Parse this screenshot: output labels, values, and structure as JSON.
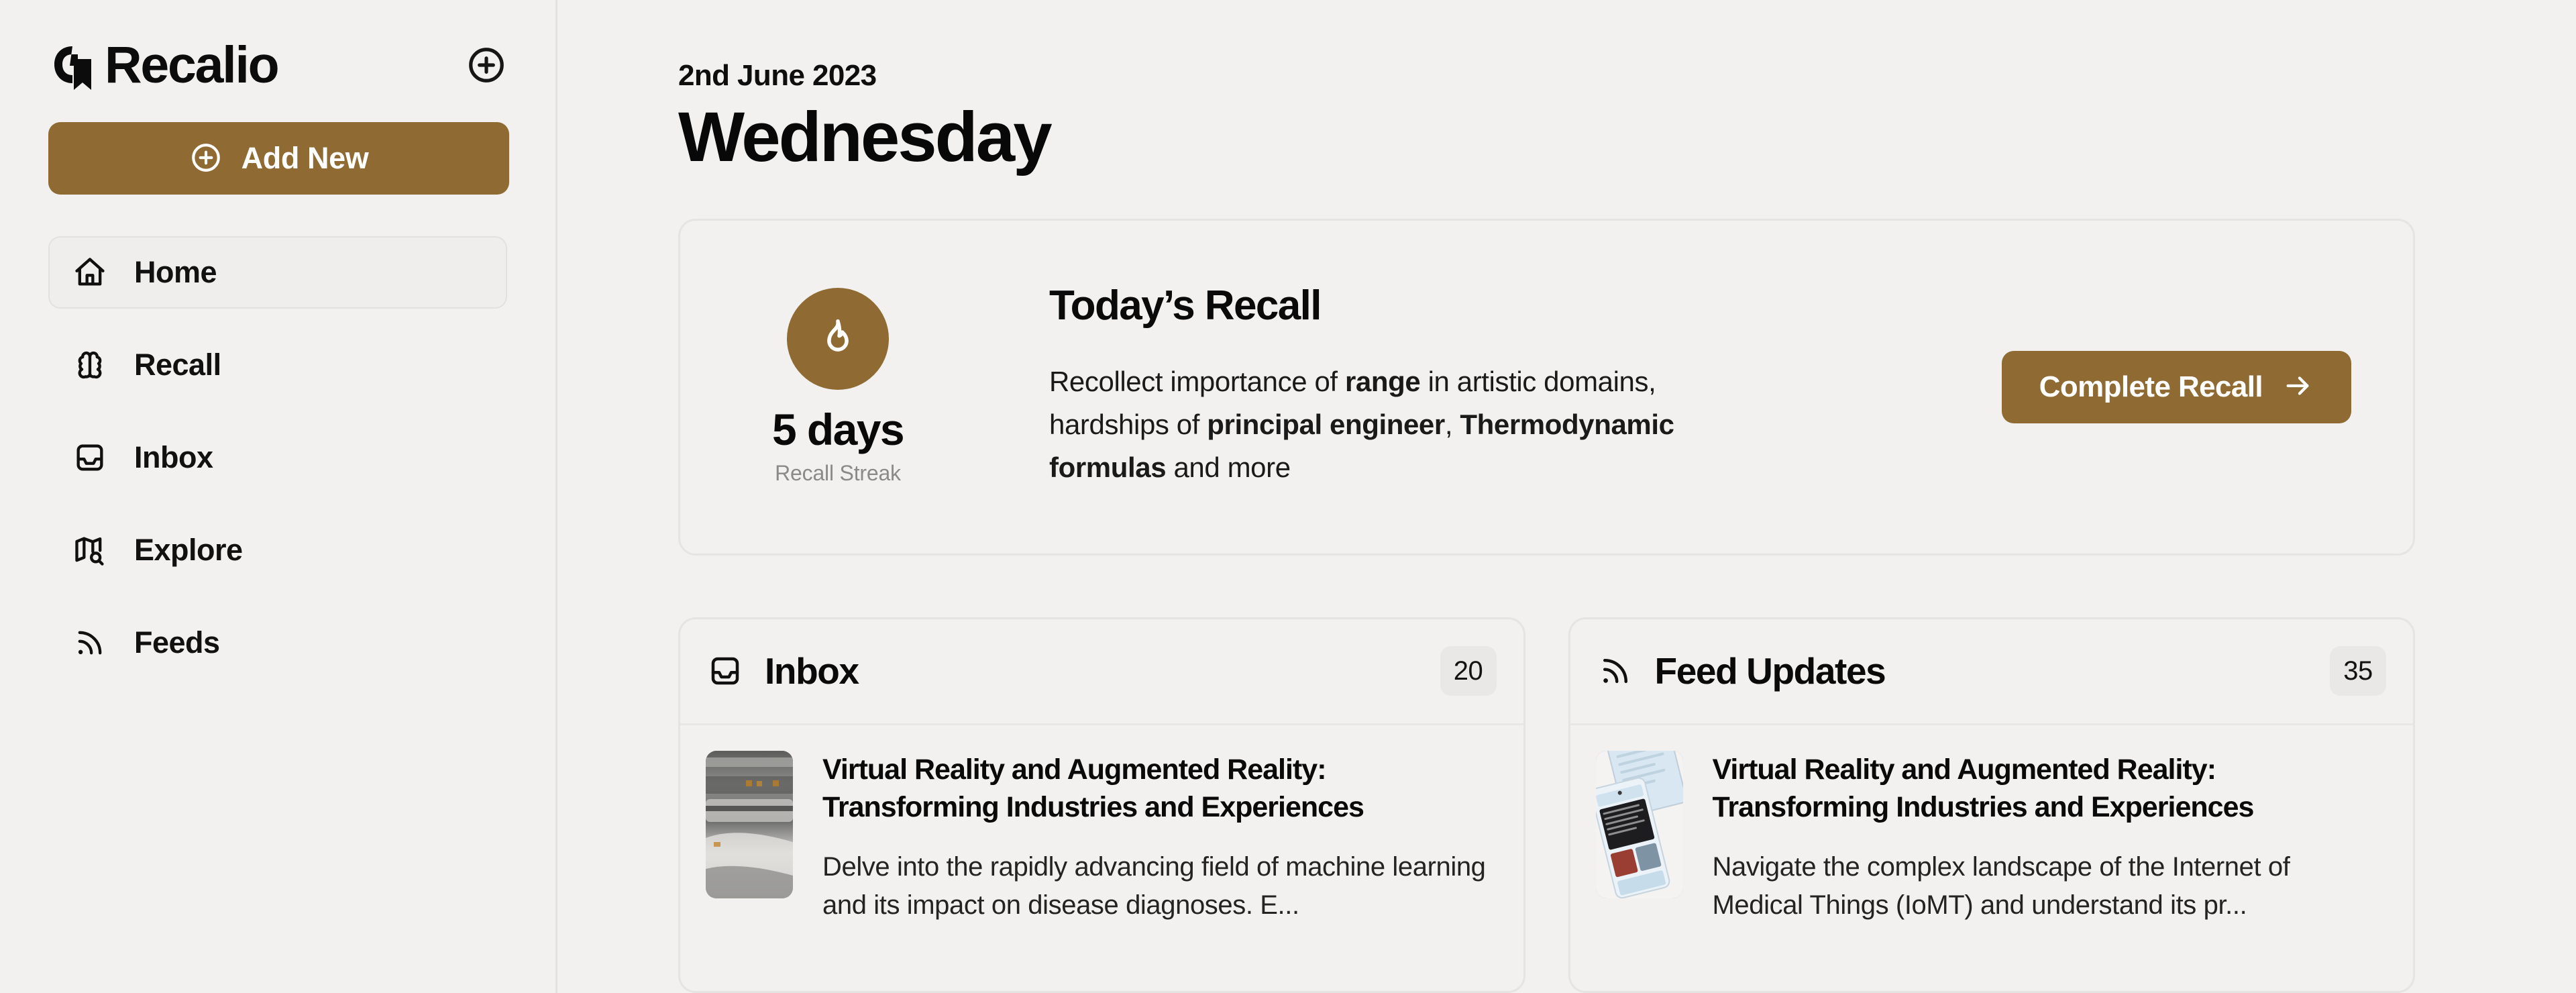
{
  "theme": {
    "background": "#F2F1EF",
    "accent": "#8F6A33",
    "border": "#E5E4E2",
    "text": "#0A0A0A",
    "muted": "#8C8A86"
  },
  "sidebar": {
    "brand_name": "Recalio",
    "brand_icon": "recalio-bookmark-logo",
    "header_add_icon": "circle-plus-icon",
    "add_new": {
      "label": "Add New",
      "icon": "circle-plus-icon"
    },
    "items": [
      {
        "label": "Home",
        "icon": "home-icon",
        "active": true
      },
      {
        "label": "Recall",
        "icon": "brain-icon",
        "active": false
      },
      {
        "label": "Inbox",
        "icon": "inbox-icon",
        "active": false
      },
      {
        "label": "Explore",
        "icon": "map-search-icon",
        "active": false
      },
      {
        "label": "Feeds",
        "icon": "rss-icon",
        "active": false
      }
    ]
  },
  "main": {
    "date": "2nd June 2023",
    "day": "Wednesday",
    "recall_card": {
      "streak_icon": "flame-icon",
      "streak_count": "5 days",
      "streak_label": "Recall Streak",
      "title": "Today’s Recall",
      "description_parts": [
        {
          "text": "Recollect importance of ",
          "bold": false
        },
        {
          "text": "range",
          "bold": true
        },
        {
          "text": " in artistic domains, hardships of ",
          "bold": false
        },
        {
          "text": "principal engineer",
          "bold": true
        },
        {
          "text": ", ",
          "bold": false
        },
        {
          "text": "Thermodynamic formulas",
          "bold": true
        },
        {
          "text": " and more",
          "bold": false
        }
      ],
      "cta_label": "Complete Recall",
      "cta_icon": "arrow-right-icon"
    },
    "panels": [
      {
        "id": "inbox",
        "title": "Inbox",
        "icon": "inbox-icon",
        "count": "20",
        "items": [
          {
            "title": "Virtual Reality and Augmented Reality: Transforming Industries and Experiences",
            "description": "Delve into the rapidly advancing field of machine learning and its impact on disease diagnoses. E...",
            "thumbnail": "printing-press-newspaper-photo"
          }
        ]
      },
      {
        "id": "feed-updates",
        "title": "Feed Updates",
        "icon": "rss-icon",
        "count": "35",
        "items": [
          {
            "title": "Virtual Reality and Augmented Reality: Transforming Industries and Experiences",
            "description": "Navigate the complex landscape of the Internet of Medical Things (IoMT) and understand its pr...",
            "thumbnail": "tablet-phone-news-photo"
          }
        ]
      }
    ]
  }
}
